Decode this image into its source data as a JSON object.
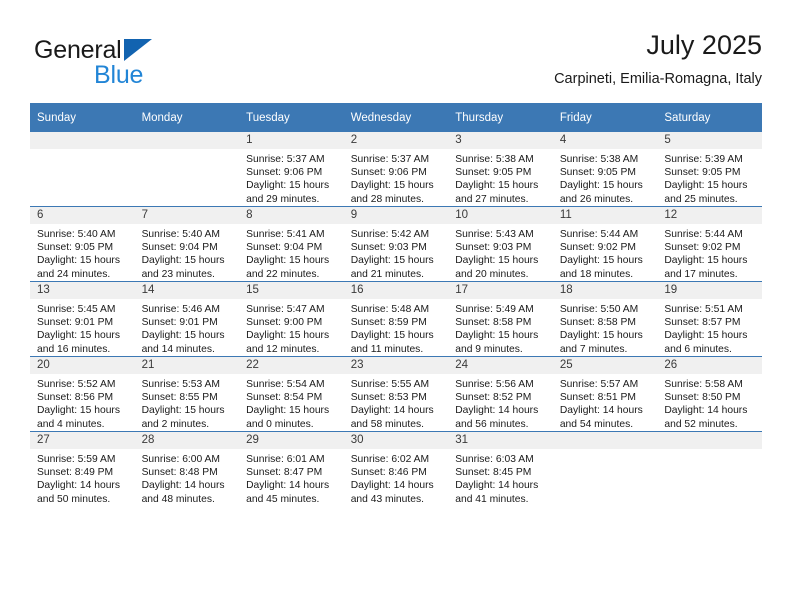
{
  "brand": {
    "name_top": "General",
    "name_bottom": "Blue",
    "triangle_color": "#1263b0",
    "blue_text_color": "#2285d6"
  },
  "header": {
    "month_title": "July 2025",
    "location": "Carpineti, Emilia-Romagna, Italy"
  },
  "theme": {
    "header_blue": "#3c78b4",
    "daynum_band": "#f0f0f0",
    "text": "#1a1a1a"
  },
  "weekdays": [
    "Sunday",
    "Monday",
    "Tuesday",
    "Wednesday",
    "Thursday",
    "Friday",
    "Saturday"
  ],
  "weeks": [
    [
      {
        "day": "",
        "sunrise": "",
        "sunset": "",
        "daylight_1": "",
        "daylight_2": ""
      },
      {
        "day": "",
        "sunrise": "",
        "sunset": "",
        "daylight_1": "",
        "daylight_2": ""
      },
      {
        "day": "1",
        "sunrise": "Sunrise: 5:37 AM",
        "sunset": "Sunset: 9:06 PM",
        "daylight_1": "Daylight: 15 hours",
        "daylight_2": "and 29 minutes."
      },
      {
        "day": "2",
        "sunrise": "Sunrise: 5:37 AM",
        "sunset": "Sunset: 9:06 PM",
        "daylight_1": "Daylight: 15 hours",
        "daylight_2": "and 28 minutes."
      },
      {
        "day": "3",
        "sunrise": "Sunrise: 5:38 AM",
        "sunset": "Sunset: 9:05 PM",
        "daylight_1": "Daylight: 15 hours",
        "daylight_2": "and 27 minutes."
      },
      {
        "day": "4",
        "sunrise": "Sunrise: 5:38 AM",
        "sunset": "Sunset: 9:05 PM",
        "daylight_1": "Daylight: 15 hours",
        "daylight_2": "and 26 minutes."
      },
      {
        "day": "5",
        "sunrise": "Sunrise: 5:39 AM",
        "sunset": "Sunset: 9:05 PM",
        "daylight_1": "Daylight: 15 hours",
        "daylight_2": "and 25 minutes."
      }
    ],
    [
      {
        "day": "6",
        "sunrise": "Sunrise: 5:40 AM",
        "sunset": "Sunset: 9:05 PM",
        "daylight_1": "Daylight: 15 hours",
        "daylight_2": "and 24 minutes."
      },
      {
        "day": "7",
        "sunrise": "Sunrise: 5:40 AM",
        "sunset": "Sunset: 9:04 PM",
        "daylight_1": "Daylight: 15 hours",
        "daylight_2": "and 23 minutes."
      },
      {
        "day": "8",
        "sunrise": "Sunrise: 5:41 AM",
        "sunset": "Sunset: 9:04 PM",
        "daylight_1": "Daylight: 15 hours",
        "daylight_2": "and 22 minutes."
      },
      {
        "day": "9",
        "sunrise": "Sunrise: 5:42 AM",
        "sunset": "Sunset: 9:03 PM",
        "daylight_1": "Daylight: 15 hours",
        "daylight_2": "and 21 minutes."
      },
      {
        "day": "10",
        "sunrise": "Sunrise: 5:43 AM",
        "sunset": "Sunset: 9:03 PM",
        "daylight_1": "Daylight: 15 hours",
        "daylight_2": "and 20 minutes."
      },
      {
        "day": "11",
        "sunrise": "Sunrise: 5:44 AM",
        "sunset": "Sunset: 9:02 PM",
        "daylight_1": "Daylight: 15 hours",
        "daylight_2": "and 18 minutes."
      },
      {
        "day": "12",
        "sunrise": "Sunrise: 5:44 AM",
        "sunset": "Sunset: 9:02 PM",
        "daylight_1": "Daylight: 15 hours",
        "daylight_2": "and 17 minutes."
      }
    ],
    [
      {
        "day": "13",
        "sunrise": "Sunrise: 5:45 AM",
        "sunset": "Sunset: 9:01 PM",
        "daylight_1": "Daylight: 15 hours",
        "daylight_2": "and 16 minutes."
      },
      {
        "day": "14",
        "sunrise": "Sunrise: 5:46 AM",
        "sunset": "Sunset: 9:01 PM",
        "daylight_1": "Daylight: 15 hours",
        "daylight_2": "and 14 minutes."
      },
      {
        "day": "15",
        "sunrise": "Sunrise: 5:47 AM",
        "sunset": "Sunset: 9:00 PM",
        "daylight_1": "Daylight: 15 hours",
        "daylight_2": "and 12 minutes."
      },
      {
        "day": "16",
        "sunrise": "Sunrise: 5:48 AM",
        "sunset": "Sunset: 8:59 PM",
        "daylight_1": "Daylight: 15 hours",
        "daylight_2": "and 11 minutes."
      },
      {
        "day": "17",
        "sunrise": "Sunrise: 5:49 AM",
        "sunset": "Sunset: 8:58 PM",
        "daylight_1": "Daylight: 15 hours",
        "daylight_2": "and 9 minutes."
      },
      {
        "day": "18",
        "sunrise": "Sunrise: 5:50 AM",
        "sunset": "Sunset: 8:58 PM",
        "daylight_1": "Daylight: 15 hours",
        "daylight_2": "and 7 minutes."
      },
      {
        "day": "19",
        "sunrise": "Sunrise: 5:51 AM",
        "sunset": "Sunset: 8:57 PM",
        "daylight_1": "Daylight: 15 hours",
        "daylight_2": "and 6 minutes."
      }
    ],
    [
      {
        "day": "20",
        "sunrise": "Sunrise: 5:52 AM",
        "sunset": "Sunset: 8:56 PM",
        "daylight_1": "Daylight: 15 hours",
        "daylight_2": "and 4 minutes."
      },
      {
        "day": "21",
        "sunrise": "Sunrise: 5:53 AM",
        "sunset": "Sunset: 8:55 PM",
        "daylight_1": "Daylight: 15 hours",
        "daylight_2": "and 2 minutes."
      },
      {
        "day": "22",
        "sunrise": "Sunrise: 5:54 AM",
        "sunset": "Sunset: 8:54 PM",
        "daylight_1": "Daylight: 15 hours",
        "daylight_2": "and 0 minutes."
      },
      {
        "day": "23",
        "sunrise": "Sunrise: 5:55 AM",
        "sunset": "Sunset: 8:53 PM",
        "daylight_1": "Daylight: 14 hours",
        "daylight_2": "and 58 minutes."
      },
      {
        "day": "24",
        "sunrise": "Sunrise: 5:56 AM",
        "sunset": "Sunset: 8:52 PM",
        "daylight_1": "Daylight: 14 hours",
        "daylight_2": "and 56 minutes."
      },
      {
        "day": "25",
        "sunrise": "Sunrise: 5:57 AM",
        "sunset": "Sunset: 8:51 PM",
        "daylight_1": "Daylight: 14 hours",
        "daylight_2": "and 54 minutes."
      },
      {
        "day": "26",
        "sunrise": "Sunrise: 5:58 AM",
        "sunset": "Sunset: 8:50 PM",
        "daylight_1": "Daylight: 14 hours",
        "daylight_2": "and 52 minutes."
      }
    ],
    [
      {
        "day": "27",
        "sunrise": "Sunrise: 5:59 AM",
        "sunset": "Sunset: 8:49 PM",
        "daylight_1": "Daylight: 14 hours",
        "daylight_2": "and 50 minutes."
      },
      {
        "day": "28",
        "sunrise": "Sunrise: 6:00 AM",
        "sunset": "Sunset: 8:48 PM",
        "daylight_1": "Daylight: 14 hours",
        "daylight_2": "and 48 minutes."
      },
      {
        "day": "29",
        "sunrise": "Sunrise: 6:01 AM",
        "sunset": "Sunset: 8:47 PM",
        "daylight_1": "Daylight: 14 hours",
        "daylight_2": "and 45 minutes."
      },
      {
        "day": "30",
        "sunrise": "Sunrise: 6:02 AM",
        "sunset": "Sunset: 8:46 PM",
        "daylight_1": "Daylight: 14 hours",
        "daylight_2": "and 43 minutes."
      },
      {
        "day": "31",
        "sunrise": "Sunrise: 6:03 AM",
        "sunset": "Sunset: 8:45 PM",
        "daylight_1": "Daylight: 14 hours",
        "daylight_2": "and 41 minutes."
      },
      {
        "day": "",
        "sunrise": "",
        "sunset": "",
        "daylight_1": "",
        "daylight_2": ""
      },
      {
        "day": "",
        "sunrise": "",
        "sunset": "",
        "daylight_1": "",
        "daylight_2": ""
      }
    ]
  ]
}
